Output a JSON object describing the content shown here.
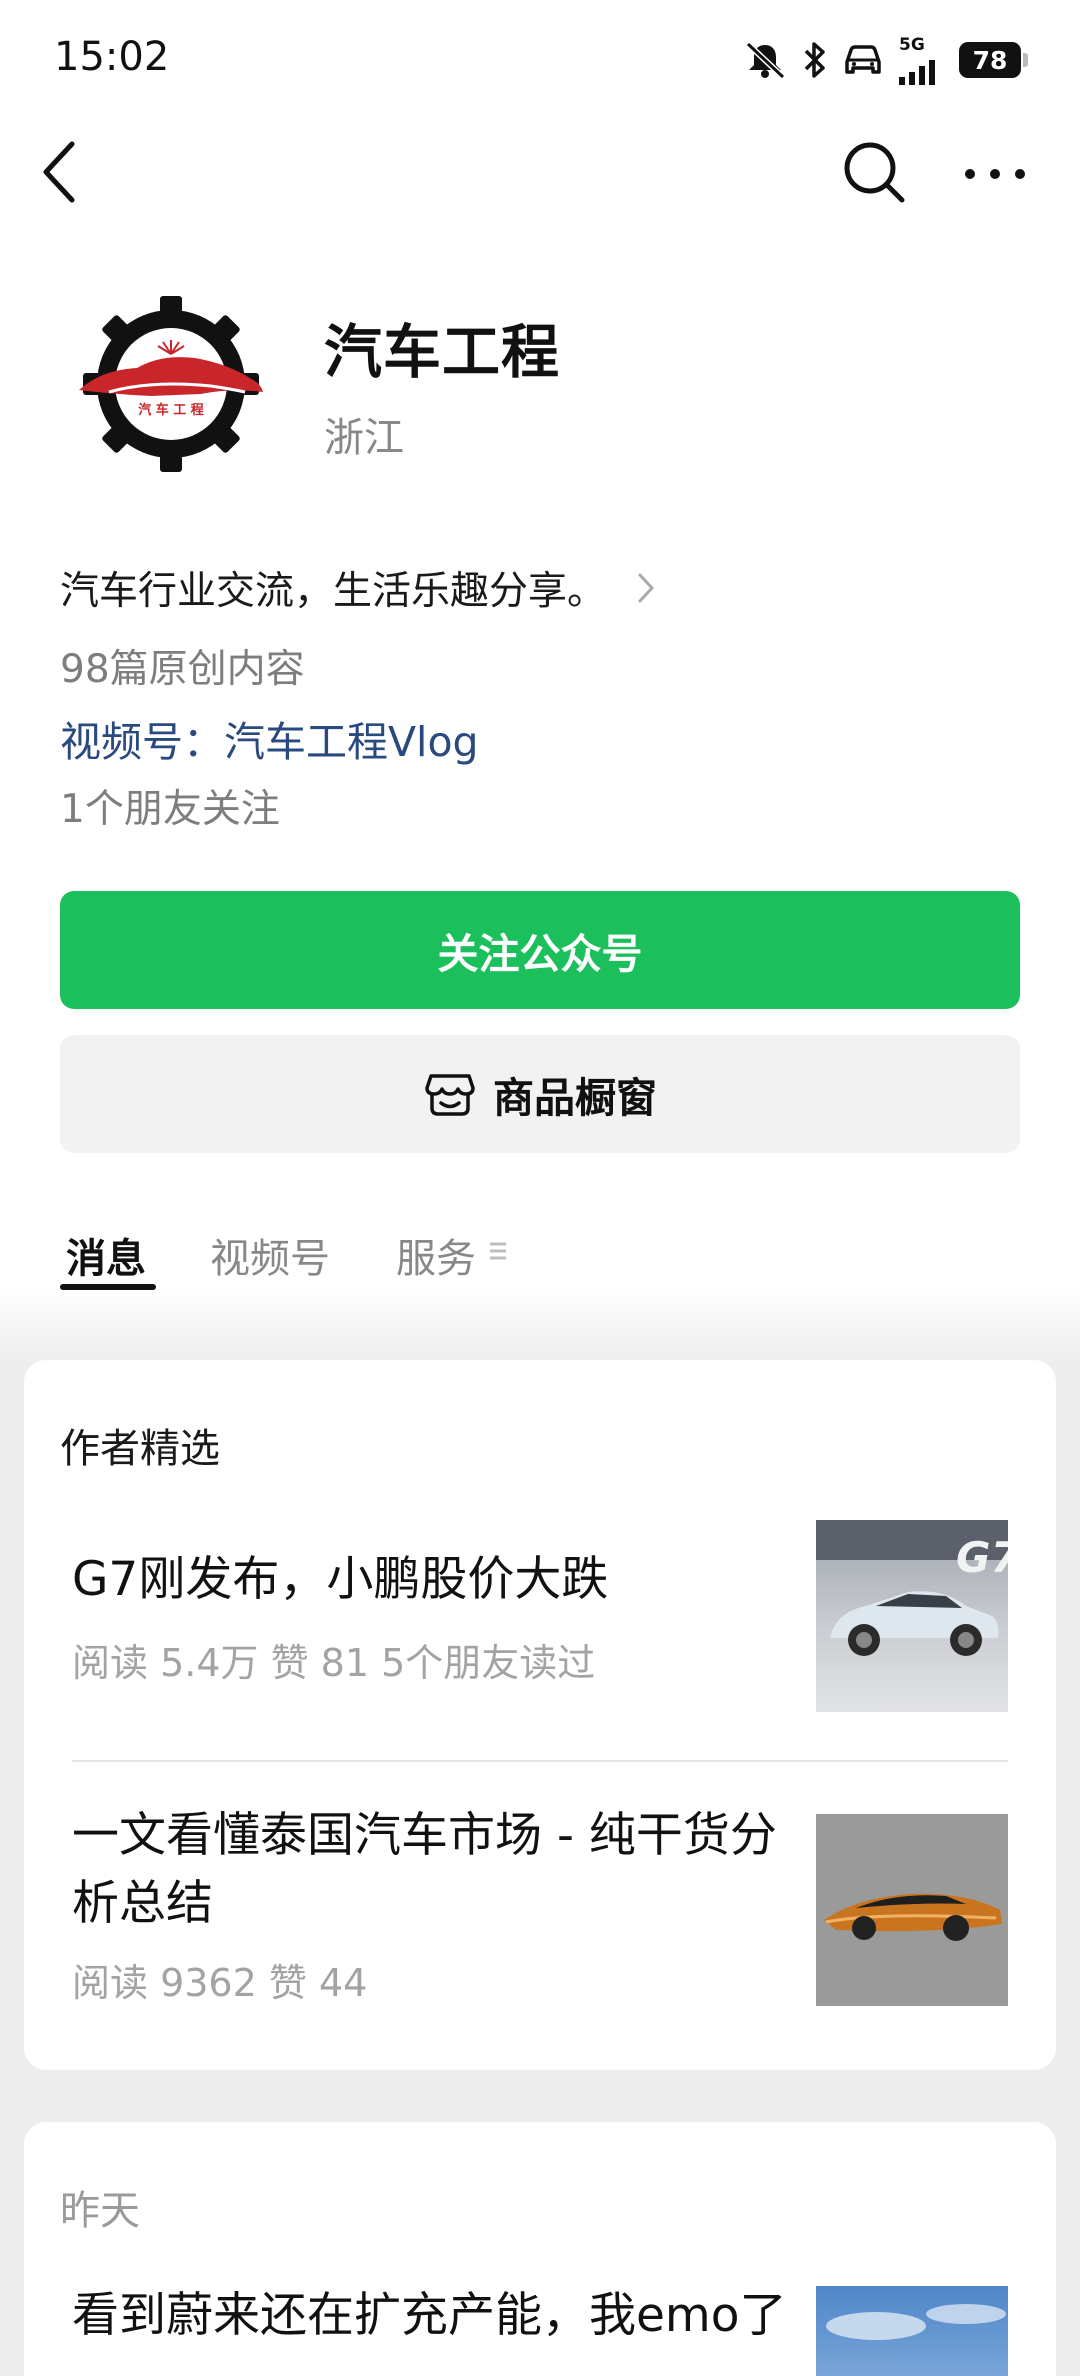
{
  "status_bar": {
    "time": "15:02",
    "network": "5G",
    "battery": "78"
  },
  "profile": {
    "name": "汽车工程",
    "region": "浙江",
    "logo_text": "汽 车 工 程",
    "intro": "汽车行业交流，生活乐趣分享。",
    "original_count": "98篇原创内容",
    "video_channel": "视频号：汽车工程Vlog",
    "friends_following": "1个朋友关注"
  },
  "actions": {
    "follow_label": "关注公众号",
    "shop_label": "商品橱窗"
  },
  "tabs": [
    {
      "label": "消息",
      "active": true
    },
    {
      "label": "视频号",
      "active": false
    },
    {
      "label": "服务",
      "active": false
    }
  ],
  "featured": {
    "title": "作者精选",
    "articles": [
      {
        "title": "G7刚发布，小鹏股价大跌",
        "meta": "阅读 5.4万   赞 81   5个朋友读过",
        "thumb_text": "G7"
      },
      {
        "title": "一文看懂泰国汽车市场 - 纯干货分析总结",
        "meta": "阅读 9362   赞 44"
      }
    ]
  },
  "recent": {
    "date": "昨天",
    "articles": [
      {
        "title": "看到蔚来还在扩充产能，我emo了"
      }
    ]
  },
  "colors": {
    "accent_green": "#1bc05c",
    "link_blue": "#2a4a7f",
    "logo_red": "#c9262b"
  }
}
